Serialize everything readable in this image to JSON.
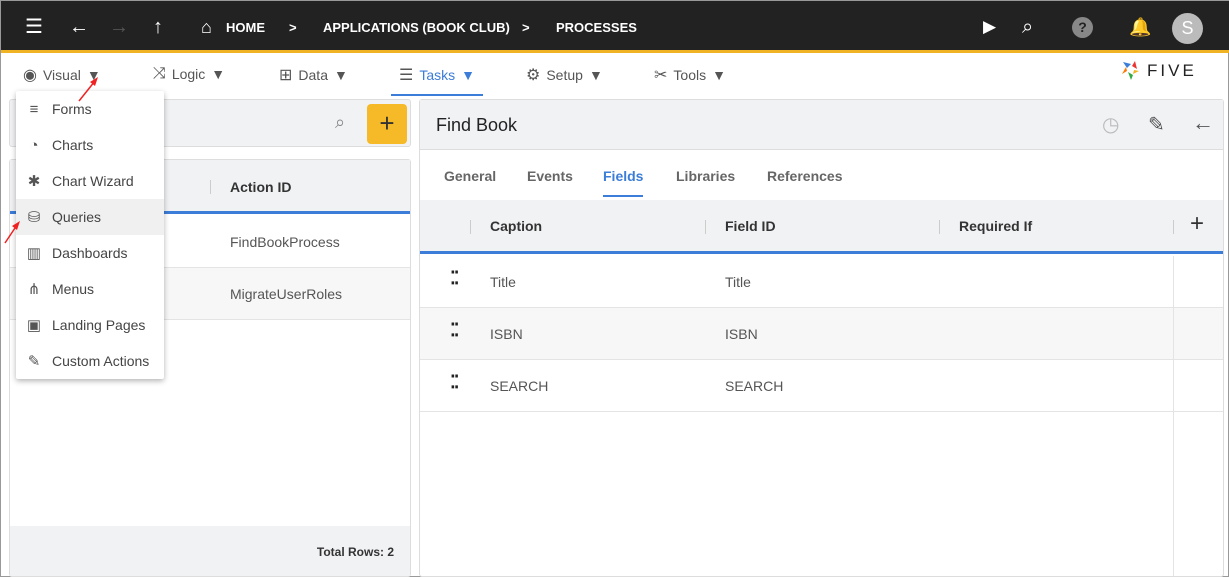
{
  "topbar": {
    "breadcrumbs": [
      "HOME",
      "APPLICATIONS (BOOK CLUB)",
      "PROCESSES"
    ],
    "avatar": "S",
    "accent": "#f0b323"
  },
  "toolbar": {
    "items": [
      {
        "label": "Visual"
      },
      {
        "label": "Logic"
      },
      {
        "label": "Data"
      },
      {
        "label": "Tasks"
      },
      {
        "label": "Setup"
      },
      {
        "label": "Tools"
      }
    ],
    "logo": "FIVE"
  },
  "menu": {
    "items": [
      "Forms",
      "Charts",
      "Chart Wizard",
      "Queries",
      "Dashboards",
      "Menus",
      "Landing Pages",
      "Custom Actions"
    ],
    "highlighted": "Queries"
  },
  "left": {
    "add_label": "+",
    "column": "Action ID",
    "rows": [
      "FindBookProcess",
      "MigrateUserRoles"
    ],
    "footer": "Total Rows: 2"
  },
  "right": {
    "title": "Find Book",
    "tabs": [
      "General",
      "Events",
      "Fields",
      "Libraries",
      "References"
    ],
    "active_tab": "Fields",
    "columns": [
      "Caption",
      "Field ID",
      "Required If"
    ],
    "add_label": "+",
    "rows": [
      {
        "caption": "Title",
        "field_id": "Title"
      },
      {
        "caption": "ISBN",
        "field_id": "ISBN"
      },
      {
        "caption": "SEARCH",
        "field_id": "SEARCH"
      }
    ]
  }
}
